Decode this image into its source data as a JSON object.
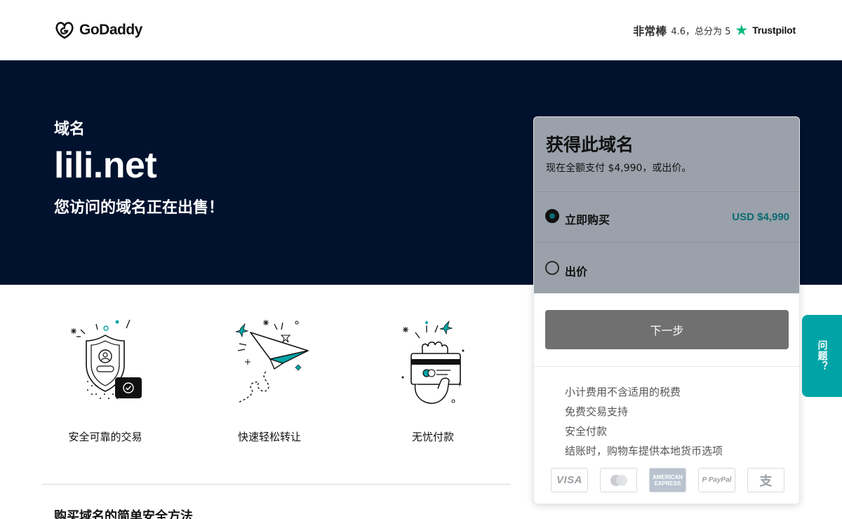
{
  "header": {
    "logo_text": "GoDaddy",
    "rating_word": "非常棒",
    "rating_score": "4.6，总分为 5",
    "trustpilot_label": "Trustpilot"
  },
  "hero": {
    "label": "域名",
    "domain": "lili.net",
    "sale_text": "您访问的域名正在出售！"
  },
  "features": [
    {
      "label": "安全可靠的交易",
      "icon": "secure-shield-icon"
    },
    {
      "label": "快速轻松转让",
      "icon": "paper-plane-icon"
    },
    {
      "label": "无忧付款",
      "icon": "hand-card-icon"
    }
  ],
  "section_title": "购买域名的简单安全方法",
  "purchase_card": {
    "title": "获得此域名",
    "subtitle": "现在全额支付 $4,990，或出价。",
    "options": [
      {
        "label": "立即购买",
        "price": "USD $4,990",
        "selected": true
      },
      {
        "label": "出价",
        "price": "",
        "selected": false
      }
    ],
    "next_button": "下一步",
    "perks": [
      "小计费用不含适用的税费",
      "免费交易支持",
      "安全付款",
      "结账时，购物车提供本地货币选项"
    ],
    "payment_methods": {
      "visa": "VISA",
      "mastercard": "mastercard-icon",
      "amex_top": "AMERICAN",
      "amex_bottom": "EXPRESS",
      "paypal": "P PayPal",
      "alipay": "支"
    }
  },
  "side_tab": {
    "label": "问题？"
  },
  "colors": {
    "hero_bg": "#00122e",
    "card_head_bg": "#9aa1aa",
    "accent_teal": "#0b6a71",
    "side_tab_bg": "#00a4a6",
    "next_button_bg": "#707070",
    "trustpilot_green": "#00b67a"
  }
}
